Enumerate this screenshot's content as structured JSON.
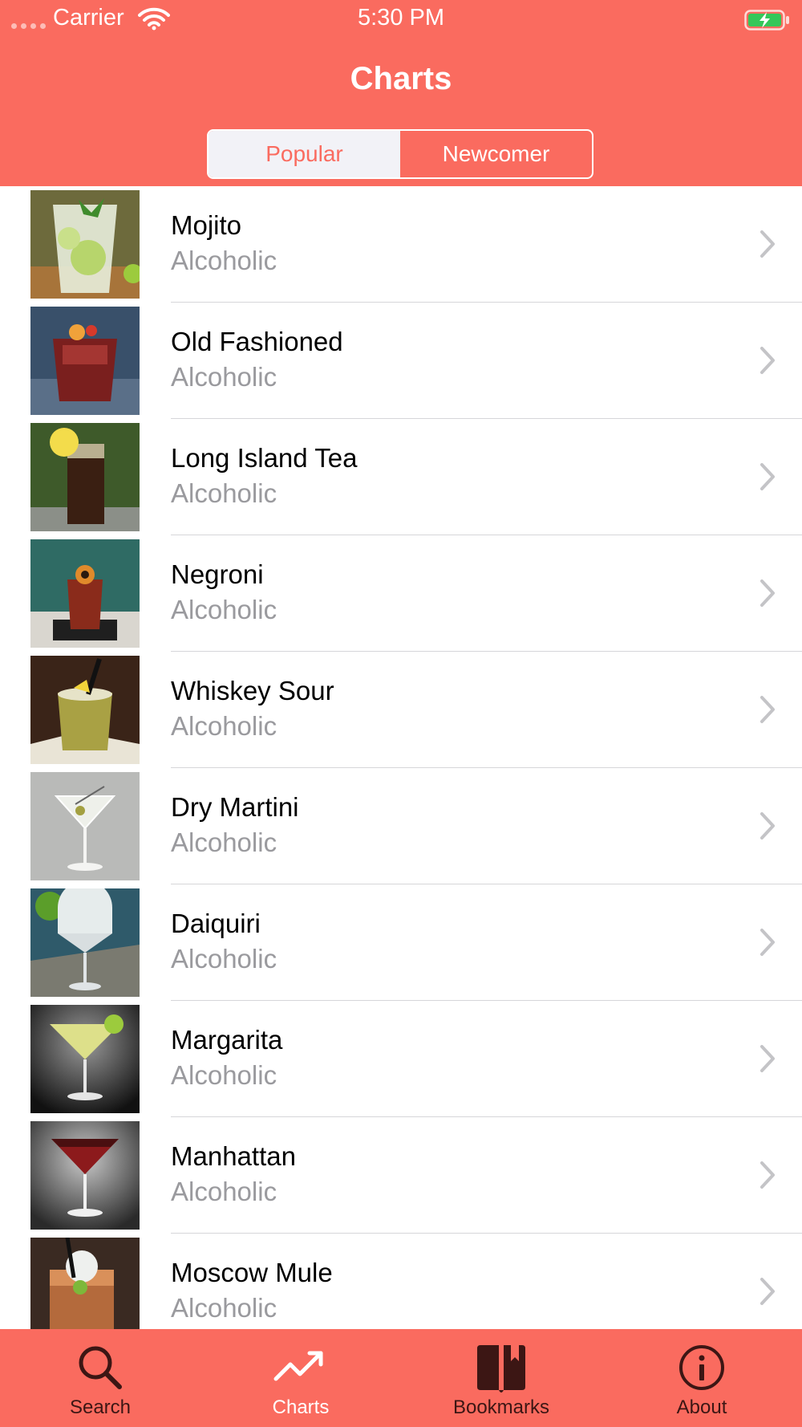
{
  "status_bar": {
    "carrier": "Carrier",
    "time": "5:30 PM"
  },
  "header": {
    "title": "Charts",
    "segments": [
      "Popular",
      "Newcomer"
    ],
    "selected_segment": "Popular"
  },
  "cocktails": [
    {
      "name": "Mojito",
      "category": "Alcoholic"
    },
    {
      "name": "Old Fashioned",
      "category": "Alcoholic"
    },
    {
      "name": "Long Island Tea",
      "category": "Alcoholic"
    },
    {
      "name": "Negroni",
      "category": "Alcoholic"
    },
    {
      "name": "Whiskey Sour",
      "category": "Alcoholic"
    },
    {
      "name": "Dry Martini",
      "category": "Alcoholic"
    },
    {
      "name": "Daiquiri",
      "category": "Alcoholic"
    },
    {
      "name": "Margarita",
      "category": "Alcoholic"
    },
    {
      "name": "Manhattan",
      "category": "Alcoholic"
    },
    {
      "name": "Moscow Mule",
      "category": "Alcoholic"
    }
  ],
  "tab_bar": {
    "items": [
      {
        "label": "Search",
        "icon": "search-icon"
      },
      {
        "label": "Charts",
        "icon": "trending-up-icon"
      },
      {
        "label": "Bookmarks",
        "icon": "book-icon"
      },
      {
        "label": "About",
        "icon": "info-icon"
      }
    ],
    "selected": "Charts"
  },
  "colors": {
    "accent": "#fa6b5f",
    "selected_tab": "#ffffff",
    "unselected_tab": "#3c1614",
    "secondary_text": "#9a9a9e"
  }
}
